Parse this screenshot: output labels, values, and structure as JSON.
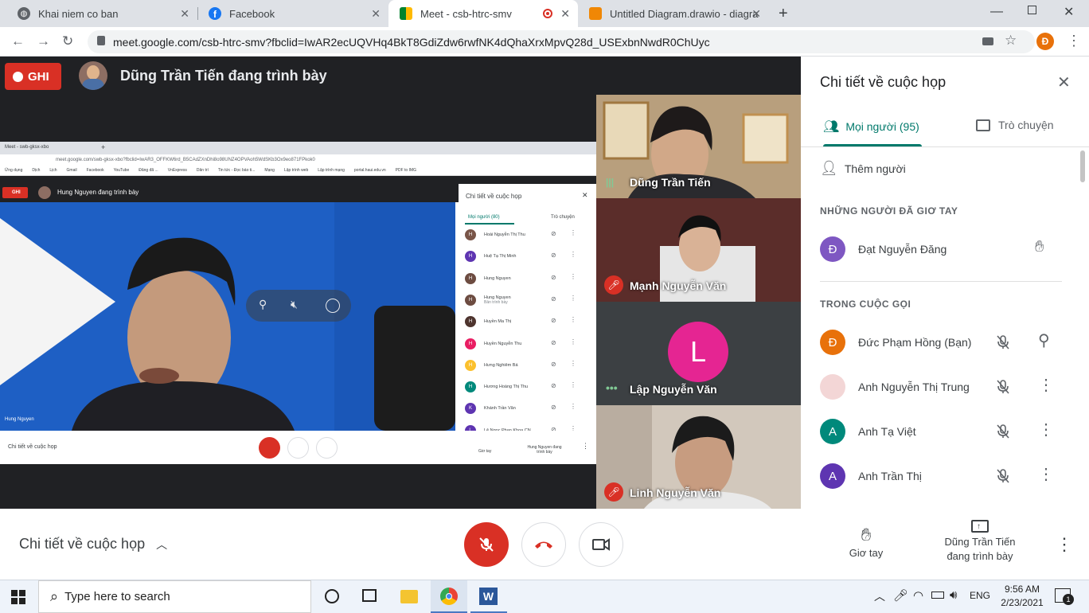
{
  "browser": {
    "tabs": [
      {
        "title": "Khai niem co ban"
      },
      {
        "title": "Facebook"
      },
      {
        "title": "Meet - csb-htrc-smv"
      },
      {
        "title": "Untitled Diagram.drawio - diagra"
      }
    ],
    "url": "meet.google.com/csb-htrc-smv?fbclid=IwAR2ecUQVHq4BkT8GdiZdw6rwfNK4dQhaXrxMpvQ28d_USExbnNwdR0ChUyc",
    "profile_initial": "Đ"
  },
  "meet": {
    "record_label": "GHI",
    "presenter_title": "Dũng Trần Tiến đang trình bày",
    "shared_screen": {
      "url": "meet.google.com/swb-gksx-xbo?fbclid=IwAR3_OFFKW6rd_B5CAdZXnDhi8o98UNZ4OPVAoh5WdSKb3Ox9eo871FPkok0",
      "tab_title": "Meet - swb-gksx-xbo",
      "bookmarks": [
        "Ứng dụng",
        "Dịch",
        "Lịch",
        "Gmail",
        "Facebook",
        "YouTube",
        "Đăng đã ...",
        "VnExpress",
        "Dân trí",
        "Tin tức - Đọc báo ti...",
        "Mạng",
        "Lập trình web",
        "Lập trình mạng",
        "portal.haui.edu.vn",
        "PDF to IMG"
      ],
      "record_label": "GHI",
      "presenter_title": "Hung Nguyen đang trình bày",
      "video_name": "Hung Nguyen",
      "panel_title": "Chi tiết về cuộc họp",
      "people_tab": "Mọi người (80)",
      "chat_tab": "Trò chuyện",
      "people": [
        {
          "name": "Hoài Nguyễn Thị Thu",
          "initial": "H",
          "color": "#795548"
        },
        {
          "name": "Huệ Tạ Thị Minh",
          "initial": "H",
          "color": "#5e35b1"
        },
        {
          "name": "Hung Nguyen",
          "initial": "H",
          "color": "#6d4c41"
        },
        {
          "name": "Hung Nguyen",
          "sub": "Bản trình bày",
          "initial": "H",
          "color": "#6d4c41"
        },
        {
          "name": "Huyền Ma Thị",
          "initial": "H",
          "color": "#4e342e"
        },
        {
          "name": "Huyền Nguyễn Thu",
          "initial": "H",
          "color": "#e91e63"
        },
        {
          "name": "Hưng Nghiêm Bá",
          "initial": "H",
          "color": "#fbc02d"
        },
        {
          "name": "Hương Hoàng Thị Thu",
          "initial": "H",
          "color": "#00897b"
        },
        {
          "name": "Khánh Trần Văn",
          "initial": "K",
          "color": "#5e35b1"
        },
        {
          "name": "Lê Ngọc Phan Khoa CN",
          "initial": "L",
          "color": "#5e35b1"
        }
      ],
      "bottom_left": "Chi tiết về cuộc họp",
      "raise_hand": "Giơ tay",
      "present_label": "Hung Nguyen đang trình bày"
    },
    "tiles": [
      {
        "name": "Dũng Trần Tiến",
        "muted": false
      },
      {
        "name": "Mạnh Nguyễn Văn",
        "muted": true
      },
      {
        "name": "Lập Nguyễn Văn",
        "initial": "L",
        "muted": false
      },
      {
        "name": "Linh Nguyễn Văn",
        "muted": true
      }
    ],
    "panel": {
      "title": "Chi tiết về cuộc họp",
      "people_tab": "Mọi người (95)",
      "chat_tab": "Trò chuyện",
      "add_people": "Thêm người",
      "raised_section": "NHỮNG NGƯỜI ĐÃ GIƠ TAY",
      "raised": [
        {
          "name": "Đạt Nguyễn Đăng",
          "initial": "Đ",
          "color": "#7e57c2"
        }
      ],
      "in_call_section": "TRONG CUỘC GỌI",
      "in_call": [
        {
          "name": "Đức Phạm Hồng (Bạn)",
          "initial": "Đ",
          "color": "#e8710a"
        },
        {
          "name": "Anh Nguyễn Thị Trung",
          "initial": "",
          "color": "#f3d6d6"
        },
        {
          "name": "Anh Tạ Việt",
          "initial": "A",
          "color": "#00897b"
        },
        {
          "name": "Anh Trần Thị",
          "initial": "A",
          "color": "#5e35b1"
        }
      ]
    },
    "bottom": {
      "details_label": "Chi tiết về cuộc họp",
      "raise_hand": "Giơ tay",
      "presenter_line1": "Dũng Trần Tiến",
      "presenter_line2": "đang trình bày"
    }
  },
  "taskbar": {
    "search_placeholder": "Type here to search",
    "language": "ENG",
    "time": "9:56 AM",
    "date": "2/23/2021",
    "notifications": "1"
  }
}
